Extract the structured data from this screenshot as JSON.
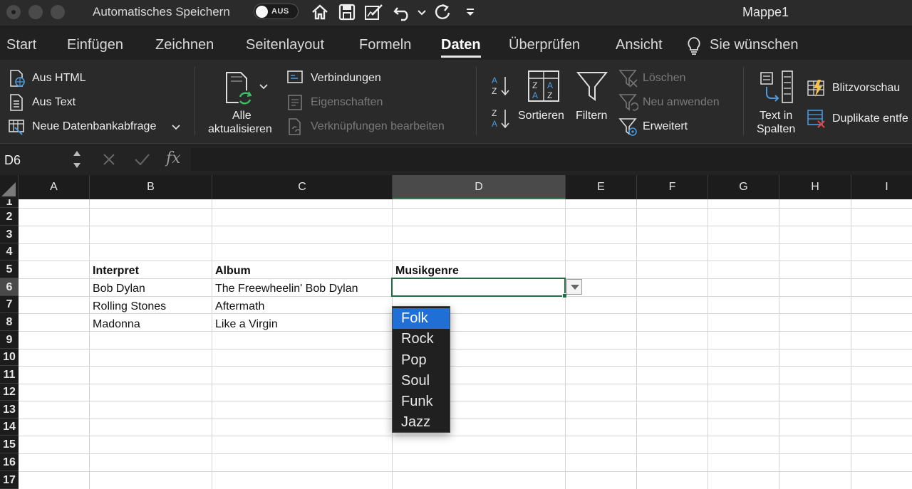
{
  "window": {
    "autosave_label": "Automatisches Speichern",
    "autosave_toggle": "AUS",
    "document_title": "Mappe1"
  },
  "tabs": [
    {
      "label": "Start"
    },
    {
      "label": "Einfügen"
    },
    {
      "label": "Zeichnen"
    },
    {
      "label": "Seitenlayout"
    },
    {
      "label": "Formeln"
    },
    {
      "label": "Daten",
      "active": true
    },
    {
      "label": "Überprüfen"
    },
    {
      "label": "Ansicht"
    }
  ],
  "tell_me": "Sie wünschen",
  "ribbon": {
    "get_data": {
      "from_html": "Aus HTML",
      "from_text": "Aus Text",
      "new_query": "Neue Datenbankabfrage"
    },
    "connections": {
      "refresh_all_1": "Alle",
      "refresh_all_2": "aktualisieren",
      "connections": "Verbindungen",
      "properties": "Eigenschaften",
      "edit_links": "Verknüpfungen bearbeiten"
    },
    "sort_filter": {
      "sort": "Sortieren",
      "filter": "Filtern",
      "clear": "Löschen",
      "reapply": "Neu anwenden",
      "advanced": "Erweitert"
    },
    "data_tools": {
      "text_to_columns_1": "Text in",
      "text_to_columns_2": "Spalten",
      "flash_fill": "Blitzvorschau",
      "remove_duplicates": "Duplikate entfe"
    }
  },
  "formula_bar": {
    "name_box": "D6",
    "fx": "fx",
    "value": ""
  },
  "sheet": {
    "columns": [
      "A",
      "B",
      "C",
      "D",
      "E",
      "F",
      "G",
      "H",
      "I"
    ],
    "selected_column": "D",
    "rows": [
      "1",
      "2",
      "3",
      "4",
      "5",
      "6",
      "7",
      "8",
      "9",
      "10",
      "11",
      "12",
      "13",
      "14",
      "15",
      "16",
      "17"
    ],
    "selected_row": "6",
    "headers": {
      "interpret": "Interpret",
      "album": "Album",
      "genre": "Musikgenre"
    },
    "data": [
      {
        "interpret": "Bob Dylan",
        "album": "The Freewheelin' Bob Dylan"
      },
      {
        "interpret": "Rolling Stones",
        "album": "Aftermath"
      },
      {
        "interpret": "Madonna",
        "album": "Like a Virgin"
      }
    ]
  },
  "dropdown": {
    "options": [
      "Folk",
      "Rock",
      "Pop",
      "Soul",
      "Funk",
      "Jazz"
    ],
    "highlighted": "Folk"
  }
}
